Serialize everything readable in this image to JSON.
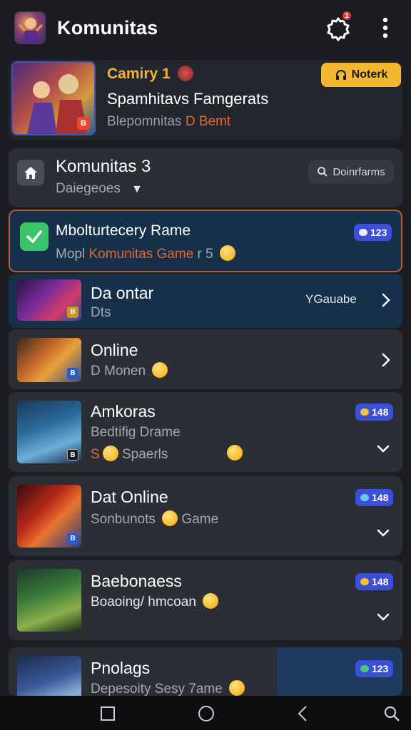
{
  "header": {
    "title": "Komunitas",
    "notification_count": "1",
    "icons": [
      "app-logo",
      "gear-icon",
      "more-vertical-icon"
    ]
  },
  "featured": {
    "line1": "Camiry 1",
    "line2": "Spamhitavs Famgerats",
    "line3_prefix": "Blepomnitas",
    "line3_accent": "D Bemt",
    "thumb_tag": "B",
    "button": "Noterk"
  },
  "community": {
    "title": "Komunitas 3",
    "subtitle": "Daiegeoes",
    "search_label": "Doinrfarms"
  },
  "rows": [
    {
      "title": "Mbolturtecery Rame",
      "sub_prefix": "Mopl ",
      "sub_accent": "Komunitas Game",
      "sub_suffix": " r 5",
      "badge": "123",
      "badge_color": "#3b4fd8"
    },
    {
      "title": "Da ontar",
      "sub": "Dts",
      "right_text": "YGauabe",
      "thumb_tag": "B"
    },
    {
      "title": "Online",
      "sub": "D Monen",
      "thumb_tag": "B"
    },
    {
      "title": "Amkoras",
      "sub": "Bedtifig Drame",
      "sub2": "Spaerls",
      "sub2_prefix": "S",
      "badge": "148",
      "thumb_tag": "B"
    },
    {
      "title": "Dat Online",
      "sub": "Sonbunots",
      "sub_suffix": "Game",
      "badge": "148",
      "thumb_tag": "B"
    },
    {
      "title": "Baebonaess",
      "sub": "Boaoing/ hmcoan",
      "badge": "148"
    },
    {
      "title": "Pnolags",
      "sub": "Depesoity Sesy 7ame",
      "badge": "123"
    }
  ],
  "colors": {
    "background": "#1b1d22",
    "card": "#2b2e35",
    "selected_card": "#163049",
    "accent_orange": "#e0673a",
    "badge_blue": "#3b4fd8",
    "notif_yellow": "#f4b731",
    "check_green": "#3bc46b"
  },
  "navbar": {
    "icons": [
      "recent-apps-icon",
      "home-icon",
      "back-icon",
      "search-icon"
    ]
  }
}
